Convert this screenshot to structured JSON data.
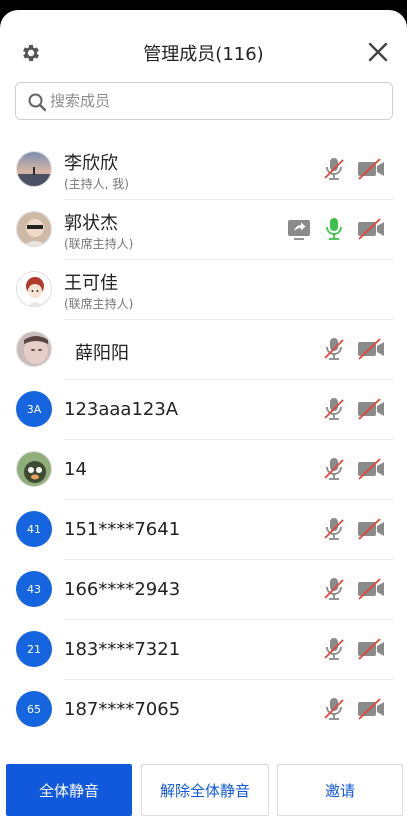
{
  "header": {
    "title": "管理成员(116)"
  },
  "search": {
    "placeholder": "搜索成员"
  },
  "members": [
    {
      "name": "李欣欣",
      "role": "(主持人, 我)",
      "avatar": "photo-sunset",
      "mic": "muted",
      "camera": "off",
      "share": false
    },
    {
      "name": "郭状杰",
      "role": "(联席主持人)",
      "avatar": "photo-person",
      "mic": "active",
      "camera": "off",
      "share": true
    },
    {
      "name": "王可佳",
      "role": "(联席主持人)",
      "avatar": "photo-cartoon",
      "mic": null,
      "camera": null,
      "share": false
    },
    {
      "name": "薛阳阳",
      "role": "",
      "avatar": "photo-face",
      "mic": "muted",
      "camera": "off",
      "share": false
    },
    {
      "name": "123aaa123A",
      "role": "",
      "avatar_text": "3A",
      "mic": "muted",
      "camera": "off",
      "share": false
    },
    {
      "name": "14",
      "role": "",
      "avatar": "photo-creature",
      "mic": "muted",
      "camera": "off",
      "share": false
    },
    {
      "name": "151****7641",
      "role": "",
      "avatar_text": "41",
      "mic": "muted",
      "camera": "off",
      "share": false
    },
    {
      "name": "166****2943",
      "role": "",
      "avatar_text": "43",
      "mic": "muted",
      "camera": "off",
      "share": false
    },
    {
      "name": "183****7321",
      "role": "",
      "avatar_text": "21",
      "mic": "muted",
      "camera": "off",
      "share": false
    },
    {
      "name": "187****7065",
      "role": "",
      "avatar_text": "65",
      "mic": "muted",
      "camera": "off",
      "share": false
    }
  ],
  "footer": {
    "mute_all": "全体静音",
    "unmute_all": "解除全体静音",
    "invite": "邀请"
  },
  "colors": {
    "accent": "#1059dc",
    "avatar_blue": "#1565e0",
    "mic_active": "#3cc24a",
    "muted_red": "#e0463a",
    "icon_gray": "#8a8a8a"
  }
}
